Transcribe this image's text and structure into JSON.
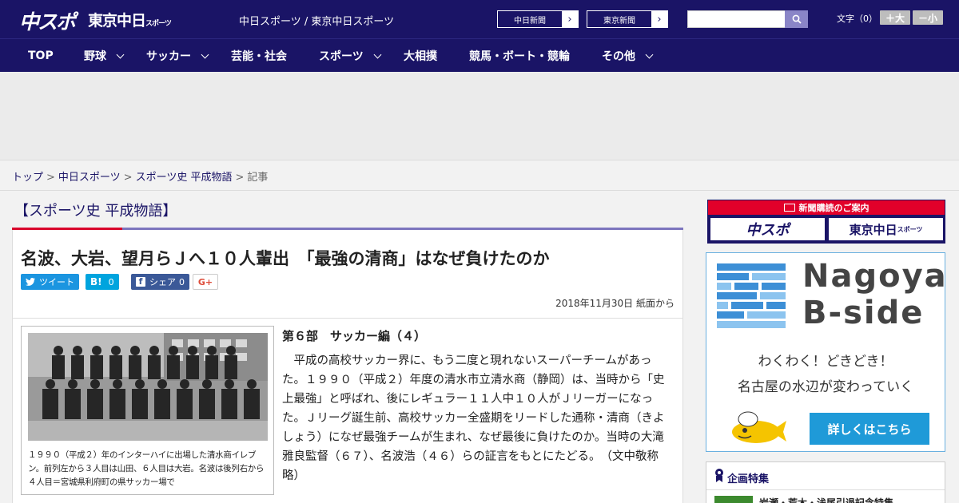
{
  "header": {
    "logo_primary": "中スポ",
    "logo_secondary": "東京中日",
    "logo_secondary_sub": "スポーツ",
    "site_names": "中日スポーツ / 東京中日スポーツ",
    "papers": [
      {
        "label": "中日新聞"
      },
      {
        "label": "東京新聞"
      }
    ],
    "search": {
      "value": "",
      "placeholder": ""
    },
    "fontsize": {
      "label": "文字（0）",
      "larger": "＋大",
      "smaller": "－小"
    }
  },
  "nav": {
    "items": [
      {
        "label": "TOP",
        "dropdown": false
      },
      {
        "label": "野球",
        "dropdown": true
      },
      {
        "label": "サッカー",
        "dropdown": true
      },
      {
        "label": "芸能・社会",
        "dropdown": false
      },
      {
        "label": "スポーツ",
        "dropdown": true
      },
      {
        "label": "大相撲",
        "dropdown": false
      },
      {
        "label": "競馬・ボート・競輪",
        "dropdown": false
      },
      {
        "label": "その他",
        "dropdown": true
      }
    ]
  },
  "breadcrumb": {
    "items": [
      "トップ",
      "中日スポーツ",
      "スポーツ史 平成物語"
    ],
    "current": "記事"
  },
  "article": {
    "section": "【スポーツ史 平成物語】",
    "headline": "名波、大岩、望月らＪへ１０人輩出　「最強の清商」はなぜ負けたのか",
    "share": {
      "tweet": "ツイート",
      "hatena": "B!",
      "hatena_count": "0",
      "facebook": "シェア",
      "facebook_count": "0",
      "gplus": "G+"
    },
    "date": "2018年11月30日 紙面から",
    "caption": "１９９０（平成２）年のインターハイに出場した清水商イレブン。前列左から３人目は山田、６人目は大岩。名波は後列右から４人目＝宮城県利府町の県サッカー場で",
    "subhead": "第６部　サッカー編（４）",
    "body": "　平成の高校サッカー界に、もう二度と現れないスーパーチームがあった。１９９０（平成２）年度の清水市立清水商（静岡）は、当時から「史上最強」と呼ばれ、後にレギュラー１１人中１０人がＪリーガーになった。Ｊリーグ誕生前、高校サッカー全盛期をリードした通称・清商（きよしょう）になぜ最強チームが生まれ、なぜ最後に負けたのか。当時の大滝雅良監督（６７）、名波浩（４６）らの証言をもとにたどる。　（文中敬称略）"
  },
  "sidebar": {
    "subscription": {
      "title": "新聞購読のご案内",
      "logo1": "中スポ",
      "logo2": "東京中日",
      "logo2_sub": "スポーツ"
    },
    "bside": {
      "title1": "Nagoya",
      "title2": "B-side",
      "tagline1": "わくわく！どきどき！",
      "tagline2": "名古屋の水辺が変わっていく",
      "button": "詳しくはこちら"
    },
    "feature": {
      "title": "企画特集",
      "item": "岩瀬・荒木・浅尾引退記念特集"
    }
  },
  "colors": {
    "brand_navy": "#1a1466",
    "accent_red": "#d9002b",
    "accent_purple": "#7d75be",
    "twitter": "#1b95e0",
    "hatena": "#00a4de",
    "facebook": "#3b5998",
    "bside_blue": "#1f9ad8"
  }
}
